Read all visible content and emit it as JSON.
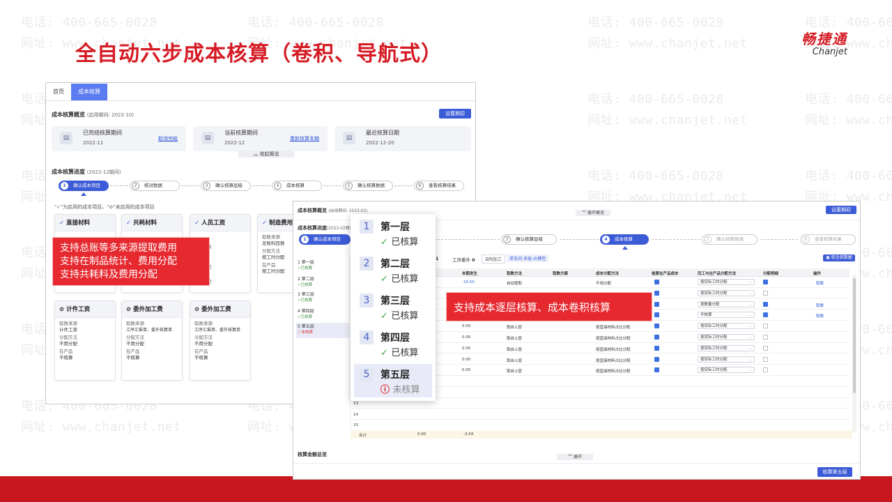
{
  "slide": {
    "title": "全自动六步成本核算（卷积、导航式）",
    "logo_cn": "畅捷通",
    "logo_en": "Chanjet",
    "watermark_phone": "电话: 400-665-0028",
    "watermark_site": "网址: www.chanjet.net",
    "accent_color": "#d51b24"
  },
  "win1": {
    "tabs": [
      "首页",
      "成本核算"
    ],
    "overview_title": "成本核算概览",
    "overview_period": "(启用期间: 2022-10)",
    "set_period_label": "设置期初",
    "overview": [
      {
        "icon": "calendar-icon",
        "label": "已完结核算期间",
        "value": "2022-11",
        "action": "取消完结"
      },
      {
        "icon": "calendar-icon",
        "label": "当前核算期间",
        "value": "2022-12",
        "action": "重新核算本期"
      },
      {
        "icon": "calendar-icon",
        "label": "最近核算日期",
        "value": "2022-12-20",
        "action": ""
      }
    ],
    "collapse_label": "收起概览",
    "progress_title": "成本核算进度",
    "progress_period": "(2022-12期间)",
    "steps": [
      {
        "n": "1",
        "label": "确认成本项目"
      },
      {
        "n": "2",
        "label": "核对数据"
      },
      {
        "n": "3",
        "label": "确认核算层级"
      },
      {
        "n": "4",
        "label": "成本核算"
      },
      {
        "n": "5",
        "label": "确认核算数据"
      },
      {
        "n": "6",
        "label": "查看核算结果"
      }
    ],
    "legend_note": "\"✓\"为启用的成本项目，\"⊘\"未启用的成本项目",
    "cards_row1": [
      {
        "title": "直接材料",
        "lines": []
      },
      {
        "title": "共耗材料",
        "lines": []
      },
      {
        "title": "人员工资",
        "lines": [
          "数",
          "",
          "",
          "配",
          "",
          "配"
        ]
      },
      {
        "title": "制造费用",
        "lines": [
          "取数来源",
          "总账科目数",
          "分配方法",
          "按工时分配",
          "在产品",
          "按工时分配"
        ]
      }
    ],
    "cards_row2": [
      {
        "title": "计件工资",
        "lines": [
          "取数来源",
          "计件工资",
          "分配方法",
          "不用分配",
          "在产品",
          "不核算"
        ]
      },
      {
        "title": "委外加工费",
        "lines": [
          "取数来源",
          "工序汇报单、委外核算单",
          "分配方法",
          "不用分配",
          "在产品",
          "不核算"
        ]
      },
      {
        "title": "委外加工费",
        "lines": [
          "取数来源",
          "工序汇报单、委外核算单",
          "分配方法",
          "不用分配",
          "在产品",
          "不核算"
        ]
      }
    ]
  },
  "note1": {
    "lines": [
      "支持总账等多来源提取费用",
      "支持在制品统计、费用分配",
      "支持共耗料及费用分配"
    ]
  },
  "note2": {
    "text": "支持成本逐层核算、成本卷积核算"
  },
  "win2": {
    "overview_title": "成本核算概览",
    "overview_period": "(启用期间: 2023-02)",
    "expand_label": "展开概览",
    "set_period_label": "设置期初",
    "progress_title": "成本核算进度",
    "progress_period": "(2023-02期间)",
    "steps": [
      {
        "n": "1",
        "label": "确认成本项目"
      },
      {
        "n": "3",
        "label": "确认核算层级"
      },
      {
        "n": "4",
        "label": "成本核算"
      },
      {
        "n": "5",
        "label": "确认核算数据"
      },
      {
        "n": "6",
        "label": "查看核算结果"
      }
    ],
    "stat_text": "工序委外",
    "stat_value": "0",
    "stat_prefix": "1",
    "chip1": "自制加工",
    "chip2": "单车间-多层-价模型",
    "fetch_label": "取全部数据",
    "layers": [
      {
        "name": "第一层",
        "state": "已核算"
      },
      {
        "name": "第二层",
        "state": "已核算"
      },
      {
        "name": "第三层",
        "state": "已核算"
      },
      {
        "name": "第四层",
        "state": "已核算"
      },
      {
        "name": "第五层",
        "state": "未核算"
      }
    ],
    "headers": [
      "本期发生",
      "取数方法",
      "取数方案",
      "成本分配方法",
      "核算在产品成本",
      "完工与在产品分配方法",
      "分配明细",
      "操作"
    ],
    "rows": [
      {
        "no": "",
        "amount": "-16.50",
        "method": "自动提取",
        "alloc": "不用分配",
        "c1": true,
        "sel": "按实际工时分配",
        "c2": true,
        "op": "取数"
      },
      {
        "no": "",
        "amount": "",
        "method": "",
        "alloc": "",
        "c1": true,
        "sel": "按实际工时分配",
        "c2": false,
        "op": ""
      },
      {
        "no": "",
        "amount": "",
        "method": "",
        "alloc": "",
        "c1": true,
        "sel": "按数量分配",
        "c2": true,
        "op": "取数"
      },
      {
        "no": "",
        "amount": "",
        "method": "",
        "alloc": "",
        "c1": true,
        "sel": "不核算",
        "c2": true,
        "op": "取数"
      },
      {
        "no": "",
        "amount": "0.00",
        "method": "取自上层",
        "alloc": "按直接材料占比分配",
        "c1": true,
        "sel": "按实际工时分配",
        "c2": false,
        "op": ""
      },
      {
        "no": "",
        "amount": "0.00",
        "method": "取自上层",
        "alloc": "按直接材料占比分配",
        "c1": true,
        "sel": "按实际工时分配",
        "c2": false,
        "op": ""
      },
      {
        "no": "",
        "amount": "0.00",
        "method": "取自上层",
        "alloc": "按直接材料占比分配",
        "c1": true,
        "sel": "按实际工时分配",
        "c2": false,
        "op": ""
      },
      {
        "no": "",
        "amount": "0.00",
        "method": "取自上层",
        "alloc": "按直接材料占比分配",
        "c1": true,
        "sel": "按实际工时分配",
        "c2": false,
        "op": ""
      },
      {
        "no": "",
        "amount": "0.00",
        "method": "取自上层",
        "alloc": "按直接材料占比分配",
        "c1": true,
        "sel": "按实际工时分配",
        "c2": false,
        "op": ""
      },
      {
        "no": "",
        "amount": "",
        "method": "",
        "alloc": "",
        "c1": false,
        "sel": "",
        "c2": false,
        "op": ""
      },
      {
        "no": "",
        "amount": "",
        "method": "",
        "alloc": "",
        "c1": false,
        "sel": "",
        "c2": false,
        "op": ""
      },
      {
        "no": "13",
        "amount": "",
        "method": "",
        "alloc": "",
        "c1": false,
        "sel": "",
        "c2": false,
        "op": ""
      },
      {
        "no": "14",
        "amount": "",
        "method": "",
        "alloc": "",
        "c1": false,
        "sel": "",
        "c2": false,
        "op": ""
      },
      {
        "no": "15",
        "amount": "",
        "method": "",
        "alloc": "",
        "c1": false,
        "sel": "",
        "c2": false,
        "op": ""
      }
    ],
    "total_label": "合计",
    "total_a": "0.00",
    "total_b": "-3.54",
    "summary_title": "核算金额总览",
    "summary_expand": "展开",
    "submit_label": "核算第五层"
  },
  "popup": {
    "items": [
      {
        "n": "1",
        "name": "第一层",
        "state": "已核算",
        "done": true
      },
      {
        "n": "2",
        "name": "第二层",
        "state": "已核算",
        "done": true
      },
      {
        "n": "3",
        "name": "第三层",
        "state": "已核算",
        "done": true
      },
      {
        "n": "4",
        "name": "第四层",
        "state": "已核算",
        "done": true
      },
      {
        "n": "5",
        "name": "第五层",
        "state": "未核算",
        "done": false
      }
    ]
  }
}
